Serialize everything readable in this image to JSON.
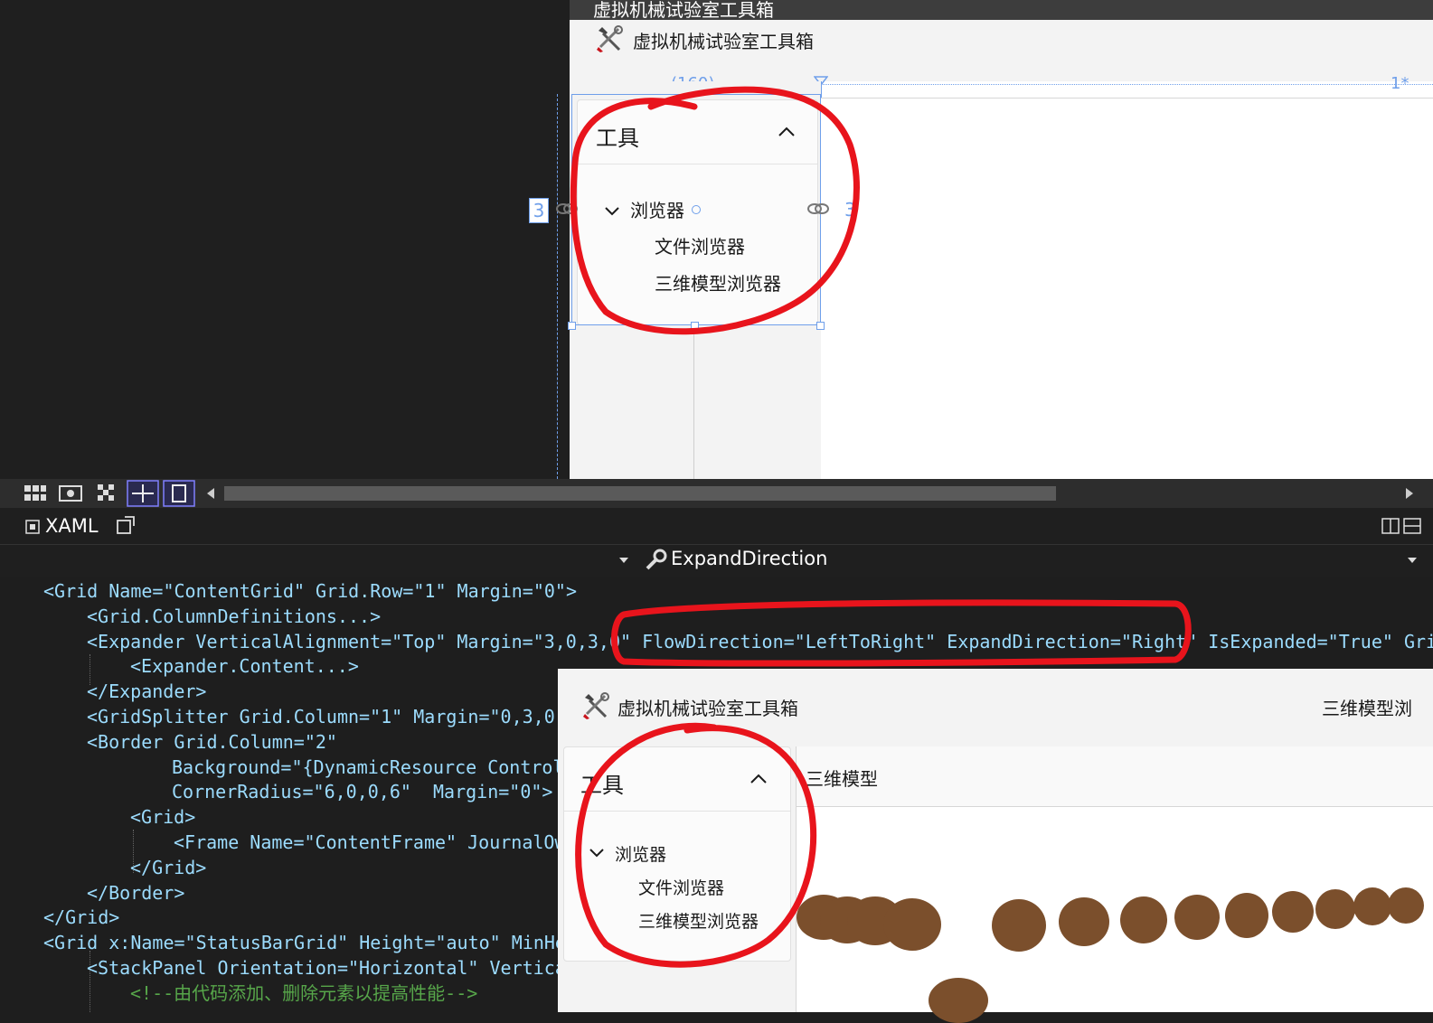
{
  "designer": {
    "window_title": "虚拟机械试验室工具箱",
    "app_title": "虚拟机械试验室工具箱",
    "col_width_label": "(160)",
    "star_label": "1*",
    "margin_left": "3",
    "margin_right": "3",
    "expander": {
      "header": "工具",
      "tree": {
        "root": "浏览器",
        "children": [
          "文件浏览器",
          "三维模型浏览器"
        ]
      }
    }
  },
  "tabs": {
    "xaml_label": "XAML",
    "property_label": "ExpandDirection"
  },
  "code": {
    "lines": [
      "<Grid Name=\"ContentGrid\" Grid.Row=\"1\" Margin=\"0\">",
      "<Grid.ColumnDefinitions...>",
      "<Expander VerticalAlignment=\"Top\" Margin=\"3,0,3,0\" FlowDirection=\"LeftToRight\" ExpandDirection=\"Right\" IsExpanded=\"True\" Gri",
      "<Expander.Content...>",
      "</Expander>",
      "<GridSplitter Grid.Column=\"1\" Margin=\"0,3,0,",
      "<Border Grid.Column=\"2\"",
      "Background=\"{DynamicResource Control",
      "CornerRadius=\"6,0,0,6\"  Margin=\"0\">",
      "<Grid>",
      "<Frame Name=\"ContentFrame\" JournalOw",
      "</Grid>",
      "</Border>",
      "</Grid>",
      "<Grid x:Name=\"StatusBarGrid\" Height=\"auto\" MinHe",
      "<StackPanel Orientation=\"Horizontal\" Vertica",
      "<!--由代码添加、删除元素以提高性能-->"
    ]
  },
  "runtime": {
    "app_title": "虚拟机械试验室工具箱",
    "right_text": "三维模型浏",
    "content_title": "三维模型",
    "expander": {
      "header": "工具",
      "tree": {
        "root": "浏览器",
        "children": [
          "文件浏览器",
          "三维模型浏览器"
        ]
      }
    }
  },
  "colors": {
    "annotation_red": "#e8141c",
    "adorner_blue": "#6f9fea",
    "dot_brown": "#7b4f2c"
  }
}
